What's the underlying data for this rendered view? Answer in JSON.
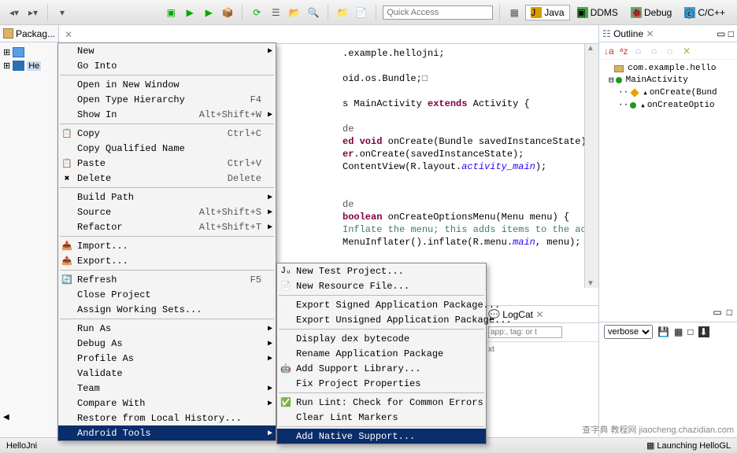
{
  "toolbar": {
    "quick_access_placeholder": "Quick Access"
  },
  "perspectives": {
    "java": "Java",
    "ddms": "DDMS",
    "debug": "Debug",
    "cpp": "C/C++"
  },
  "package_view": {
    "title": "Packag...",
    "project": "He"
  },
  "editor": {
    "lines": {
      "l1_pre": ".example.hellojni;",
      "l2_pre": "oid.os.Bundle;",
      "l2_post": "□",
      "l3_pre": "s MainActivity ",
      "l3_kw": "extends",
      "l3_post": " Activity {",
      "l4_pre": "de",
      "l5_kw": "ed void",
      "l5_name": " onCreate(Bundle savedInstanceState) {",
      "l6a": "er",
      "l6b": ".onCreate(savedInstanceState);",
      "l7a": "ContentView(R.layout.",
      "l7b": "activity_main",
      "l7c": ");",
      "l9_pre": "de",
      "l10_kw": "boolean",
      "l10_name": " onCreateOptionsMenu(Menu menu) {",
      "l11": "Inflate the menu; this adds items to the action ba",
      "l12a": "MenuInflater().inflate(R.menu.",
      "l12b": "main",
      "l12c": ", menu);"
    }
  },
  "outline": {
    "title": "Outline",
    "pkg": "com.example.hello",
    "cls": "MainActivity",
    "m1": "onCreate(Bund",
    "m2": "onCreateOptio"
  },
  "logcat": {
    "title": "LogCat",
    "search_placeholder": "app:, tag: or t",
    "verbose": "verbose",
    "col": "xt"
  },
  "context_menu": [
    {
      "t": "New",
      "sub": true
    },
    {
      "t": "Go Into"
    },
    {
      "sep": true
    },
    {
      "t": "Open in New Window"
    },
    {
      "t": "Open Type Hierarchy",
      "a": "F4"
    },
    {
      "t": "Show In",
      "a": "Alt+Shift+W",
      "sub": true
    },
    {
      "sep": true
    },
    {
      "t": "Copy",
      "a": "Ctrl+C",
      "i": "copy"
    },
    {
      "t": "Copy Qualified Name"
    },
    {
      "t": "Paste",
      "a": "Ctrl+V",
      "i": "paste"
    },
    {
      "t": "Delete",
      "a": "Delete",
      "i": "del"
    },
    {
      "sep": true
    },
    {
      "t": "Build Path",
      "sub": true
    },
    {
      "t": "Source",
      "a": "Alt+Shift+S",
      "sub": true
    },
    {
      "t": "Refactor",
      "a": "Alt+Shift+T",
      "sub": true
    },
    {
      "sep": true
    },
    {
      "t": "Import...",
      "i": "imp"
    },
    {
      "t": "Export...",
      "i": "exp"
    },
    {
      "sep": true
    },
    {
      "t": "Refresh",
      "a": "F5",
      "i": "ref"
    },
    {
      "t": "Close Project"
    },
    {
      "t": "Assign Working Sets..."
    },
    {
      "sep": true
    },
    {
      "t": "Run As",
      "sub": true
    },
    {
      "t": "Debug As",
      "sub": true
    },
    {
      "t": "Profile As",
      "sub": true
    },
    {
      "t": "Validate"
    },
    {
      "t": "Team",
      "sub": true
    },
    {
      "t": "Compare With",
      "sub": true
    },
    {
      "t": "Restore from Local History..."
    },
    {
      "t": "Android Tools",
      "sub": true,
      "sel": true
    }
  ],
  "submenu": [
    {
      "t": "New Test Project...",
      "i": "ju"
    },
    {
      "t": "New Resource File...",
      "i": "rf"
    },
    {
      "sep": true
    },
    {
      "t": "Export Signed Application Package..."
    },
    {
      "t": "Export Unsigned Application Package..."
    },
    {
      "sep": true
    },
    {
      "t": "Display dex bytecode"
    },
    {
      "t": "Rename Application Package"
    },
    {
      "t": "Add Support Library...",
      "i": "and"
    },
    {
      "t": "Fix Project Properties"
    },
    {
      "sep": true
    },
    {
      "t": "Run Lint: Check for Common Errors",
      "i": "chk"
    },
    {
      "t": "Clear Lint Markers"
    },
    {
      "sep": true
    },
    {
      "t": "Add Native Support...",
      "sel": true
    }
  ],
  "status": {
    "left": "HelloJni",
    "right": "Launching HelloGL"
  },
  "watermark": "查字典 教程网\njiaocheng.chazidian.com"
}
